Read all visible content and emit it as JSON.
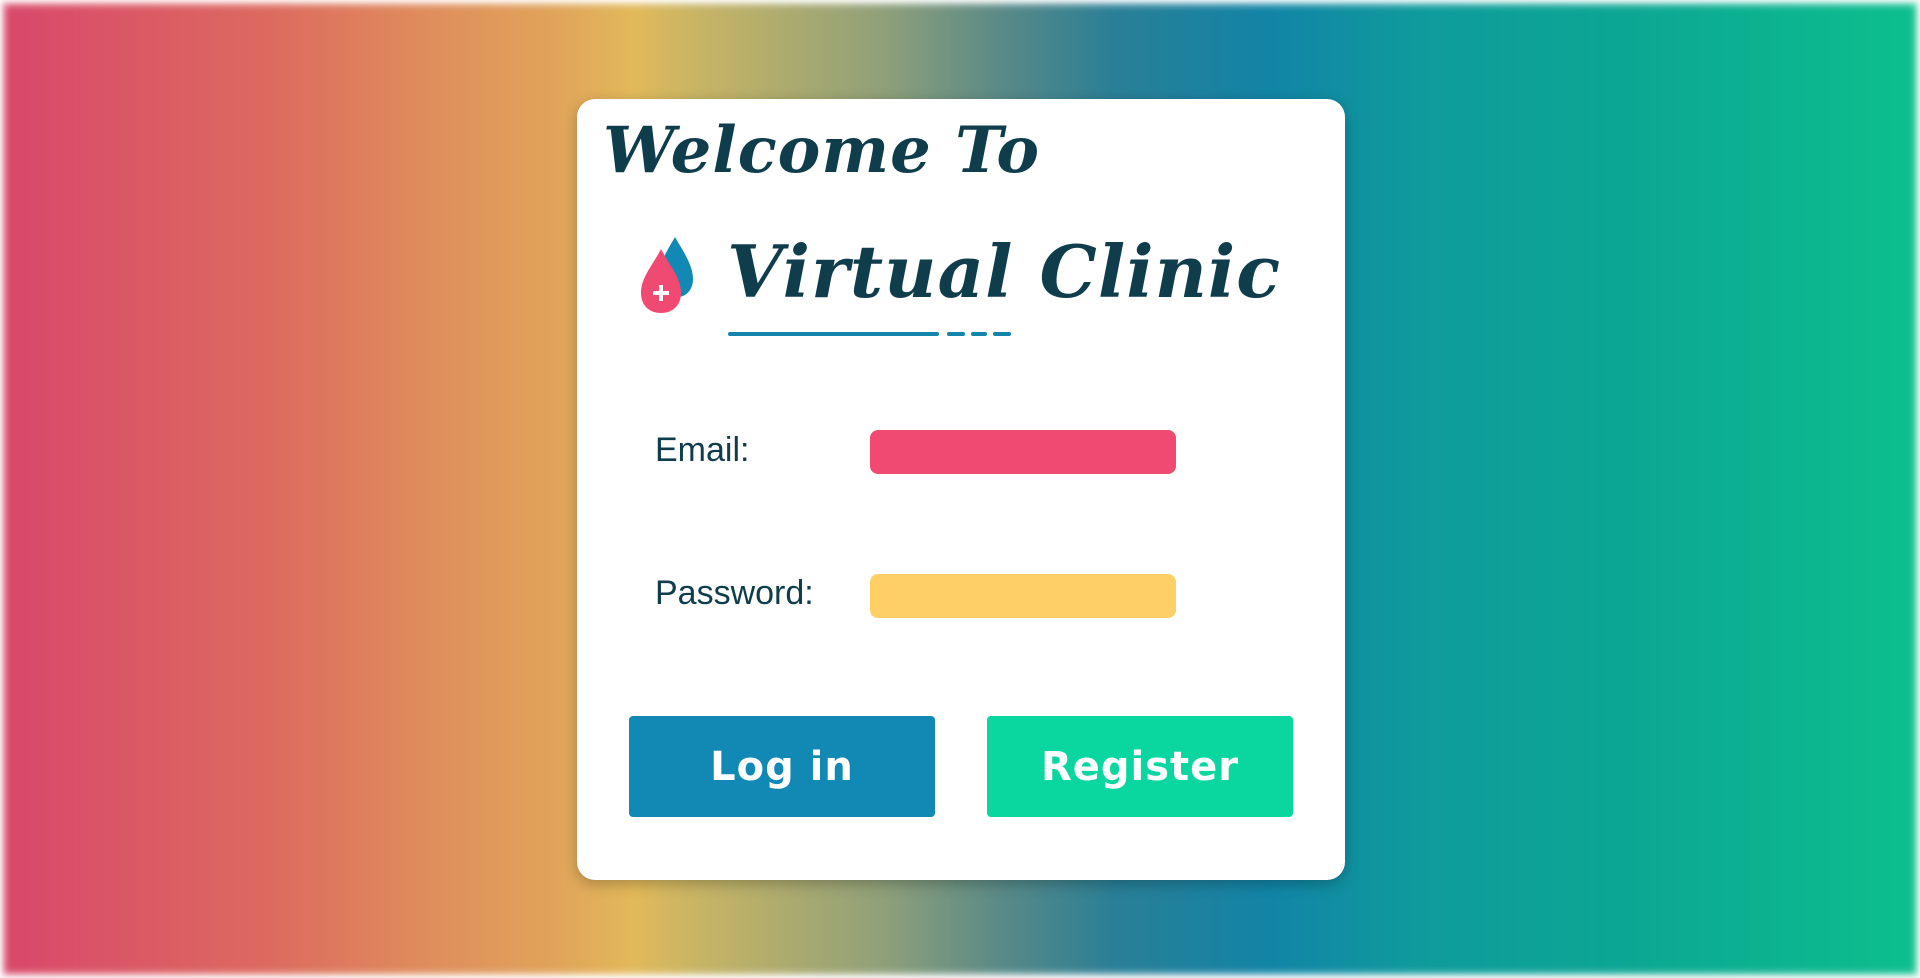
{
  "header": {
    "welcome_text": "Welcome To",
    "brand_name": "Virtual Clinic",
    "logo_icon": "blood-drop-plus-icon"
  },
  "form": {
    "email_label": "Email:",
    "email_value": "",
    "password_label": "Password:",
    "password_value": ""
  },
  "buttons": {
    "login_label": "Log in",
    "register_label": "Register"
  },
  "colors": {
    "text_dark": "#0f3d4c",
    "email_field": "#f04a72",
    "password_field": "#fdcf66",
    "login_button": "#1289b5",
    "register_button": "#0ad69f",
    "accent_blue": "#1385ab"
  }
}
